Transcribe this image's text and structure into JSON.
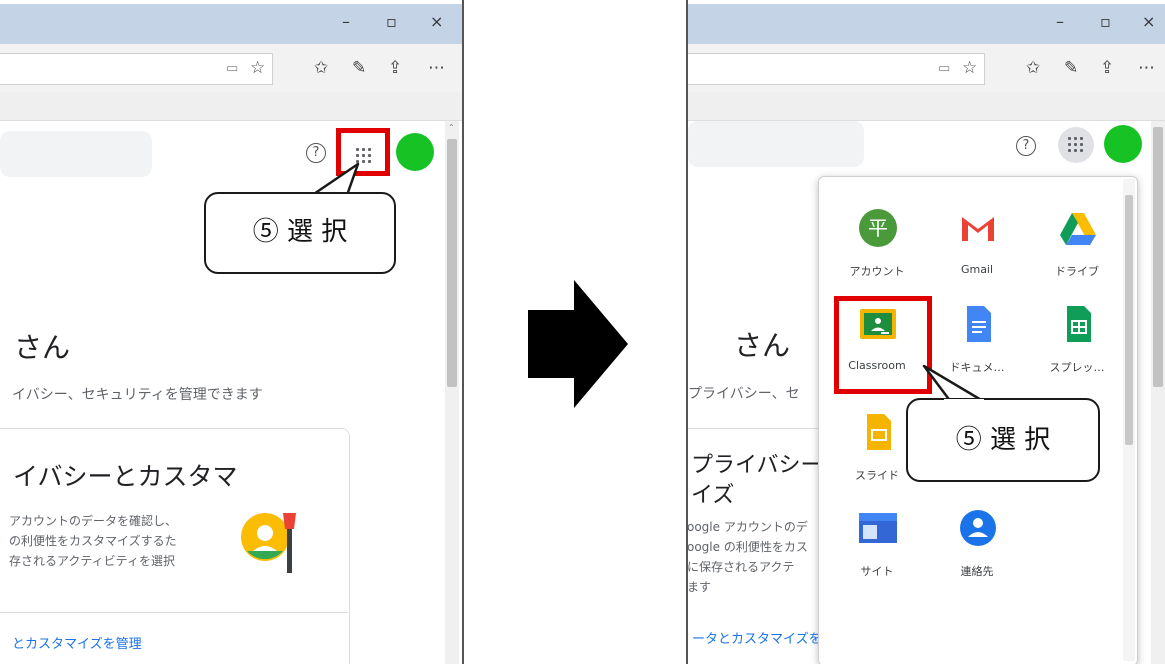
{
  "left": {
    "window_controls": {
      "minimize": "–",
      "maximize": "▫",
      "close": "×"
    },
    "heading": "さん",
    "subtext": "イバシー、セキュリティを管理できます",
    "card": {
      "title": "イバシーとカスタマ",
      "desc": [
        "アカウントのデータを確認し、",
        "の利便性をカスタマイズするた",
        "存されるアクティビティを選択"
      ],
      "link": "とカスタマイズを管理"
    },
    "callout": "⑤ 選 択"
  },
  "right": {
    "window_controls": {
      "minimize": "–",
      "maximize": "▫",
      "close": "×"
    },
    "heading": "さん",
    "subtext": "プライバシー、セ",
    "card": {
      "title_line1": "プライバシーと",
      "title_line2": "イズ",
      "desc": [
        "oogle アカウントのデ",
        "oogle の利便性をカス",
        "に保存されるアクテ",
        "ます"
      ],
      "link": "ータとカスタマイズを管理"
    },
    "apps": [
      {
        "label": "アカウント",
        "icon": "account-icon",
        "icon_char": "平",
        "color": "#4a9a3c"
      },
      {
        "label": "Gmail",
        "icon": "gmail-icon",
        "color": "#ea4335"
      },
      {
        "label": "ドライブ",
        "icon": "drive-icon",
        "color": "#fbbc04"
      },
      {
        "label": "Classroom",
        "icon": "classroom-icon",
        "color": "#1e8e3e"
      },
      {
        "label": "ドキュメ…",
        "icon": "docs-icon",
        "color": "#4285f4"
      },
      {
        "label": "スプレッ…",
        "icon": "sheets-icon",
        "color": "#0f9d58"
      },
      {
        "label": "スライド",
        "icon": "slides-icon",
        "color": "#f4b400"
      },
      {
        "label": "",
        "icon": "hidden-app-icon",
        "color": "#1a73e8"
      },
      {
        "label": "",
        "icon": "hidden-app-icon",
        "color": "#00a0b0"
      },
      {
        "label": "サイト",
        "icon": "sites-icon",
        "color": "#3367d6"
      },
      {
        "label": "連絡先",
        "icon": "contacts-icon",
        "color": "#1a73e8"
      }
    ],
    "callout": "⑤ 選 択"
  },
  "colors": {
    "highlight": "#e00000",
    "avatar": "#17c324",
    "titlebar": "#c4d3e6"
  }
}
